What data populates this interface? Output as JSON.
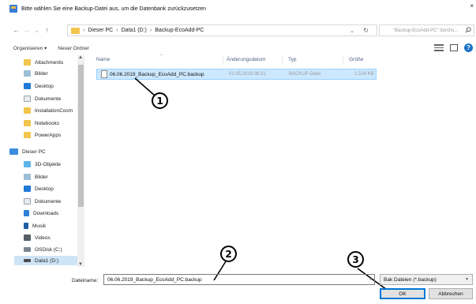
{
  "window": {
    "title": "Bitte wählen Sie eine Backup-Datei aus, um die Datenbank zurückzusetzen",
    "close_glyph": "×"
  },
  "address": {
    "breadcrumbs": [
      "Dieser PC",
      "Data1 (D:)",
      "Backup-EcoAdd-PC"
    ],
    "separator": "›",
    "search_placeholder": "\"Backup-EcoAdd-PC\" durchs..."
  },
  "toolbar": {
    "organize_label": "Organisieren ▾",
    "new_folder_label": "Neuer Ordner"
  },
  "navigation": {
    "quick_access": [
      {
        "label": "Attachments",
        "icon": "folder-icon"
      },
      {
        "label": "Bilder",
        "icon": "pictures-icon"
      },
      {
        "label": "Desktop",
        "icon": "desktop-icon"
      },
      {
        "label": "Dokumente",
        "icon": "documents-icon"
      },
      {
        "label": "InstallationCosm",
        "icon": "folder-icon"
      },
      {
        "label": "Notebooks",
        "icon": "folder-icon"
      },
      {
        "label": "PowerApps",
        "icon": "folder-icon"
      }
    ],
    "this_pc": {
      "label": "Dieser PC",
      "icon": "computer-icon"
    },
    "pc_items": [
      {
        "label": "3D-Objekte",
        "icon": "3d-objects-icon"
      },
      {
        "label": "Bilder",
        "icon": "pictures-icon"
      },
      {
        "label": "Desktop",
        "icon": "desktop-icon"
      },
      {
        "label": "Dokumente",
        "icon": "documents-icon"
      },
      {
        "label": "Downloads",
        "icon": "downloads-icon"
      },
      {
        "label": "Musik",
        "icon": "music-icon"
      },
      {
        "label": "Videos",
        "icon": "videos-icon"
      },
      {
        "label": "OSDisk (C:)",
        "icon": "drive-icon"
      },
      {
        "label": "Data1 (D:)",
        "icon": "drive-icon"
      }
    ]
  },
  "file_list": {
    "columns": [
      "Name",
      "Änderungsdatum",
      "Typ",
      "Größe"
    ],
    "rows": [
      {
        "name": "06.06.2019_Backup_EcoAdd_PC.backup",
        "date": "01.05.2019 08:31",
        "type": "BACKUP-Datei",
        "size": "1.516 KB"
      }
    ]
  },
  "bottom": {
    "filename_label": "Dateiname:",
    "filename_value": "06.06.2019_Backup_EcoAdd_PC.backup",
    "filter_value": "Bak Dateien (*.backup)",
    "ok_label": "OK",
    "cancel_label": "Abbrechen"
  },
  "callouts": [
    "1",
    "2",
    "3"
  ],
  "colors": {
    "selection": "#cce8ff",
    "selection_border": "#99d1ff",
    "nav_selection": "#cde4f7",
    "accent": "#0078d7"
  }
}
